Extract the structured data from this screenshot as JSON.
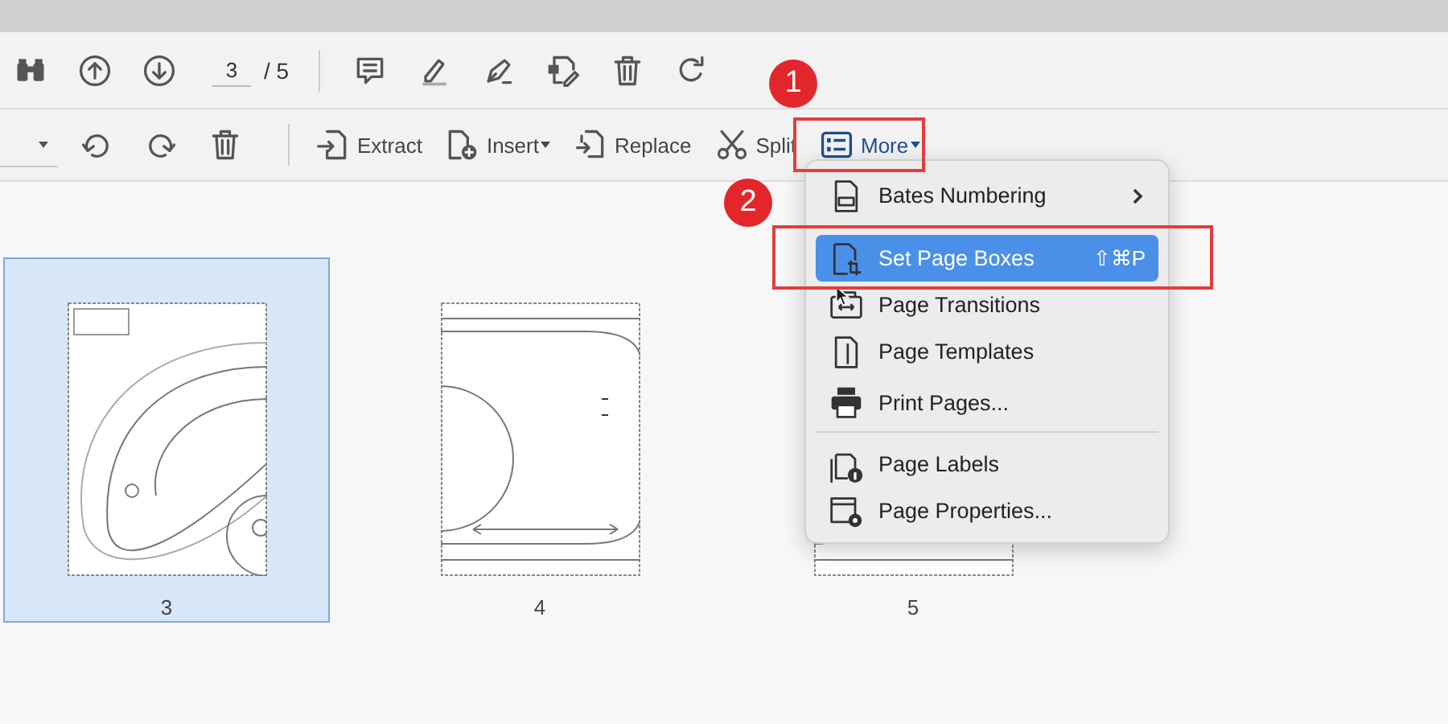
{
  "page_nav": {
    "page_field": {
      "value": "3"
    },
    "page_total": "/ 5"
  },
  "edit_toolbar": {
    "buttons": [
      {
        "label": "Extract",
        "dropdown": false,
        "open": false
      },
      {
        "label": "Insert",
        "dropdown": true,
        "open": false
      },
      {
        "label": "Replace",
        "dropdown": false,
        "open": false
      },
      {
        "label": "Split",
        "dropdown": false,
        "open": false
      },
      {
        "label": "More",
        "dropdown": true,
        "open": true
      }
    ]
  },
  "menu": {
    "items": [
      {
        "label": "Bates Numbering",
        "submenu": true,
        "selected": false,
        "divider_after": false
      },
      {
        "label": "Set Page Boxes",
        "shortcut": "⇧⌘P",
        "submenu": false,
        "selected": true,
        "divider_after": false
      },
      {
        "label": "Page Transitions",
        "submenu": false,
        "selected": false,
        "divider_after": false
      },
      {
        "label": "Page Templates",
        "submenu": false,
        "selected": false,
        "divider_after": false
      },
      {
        "label": "Print Pages...",
        "submenu": false,
        "selected": false,
        "divider_after": true
      },
      {
        "label": "Page Labels",
        "submenu": false,
        "selected": false,
        "divider_after": false
      },
      {
        "label": "Page Properties...",
        "submenu": false,
        "selected": false,
        "divider_after": false
      }
    ]
  },
  "thumbnails": [
    {
      "label": "3",
      "selected": true
    },
    {
      "label": "4",
      "selected": false
    },
    {
      "label": "5",
      "selected": false
    }
  ],
  "callouts": [
    {
      "number": "1"
    },
    {
      "number": "2"
    }
  ]
}
